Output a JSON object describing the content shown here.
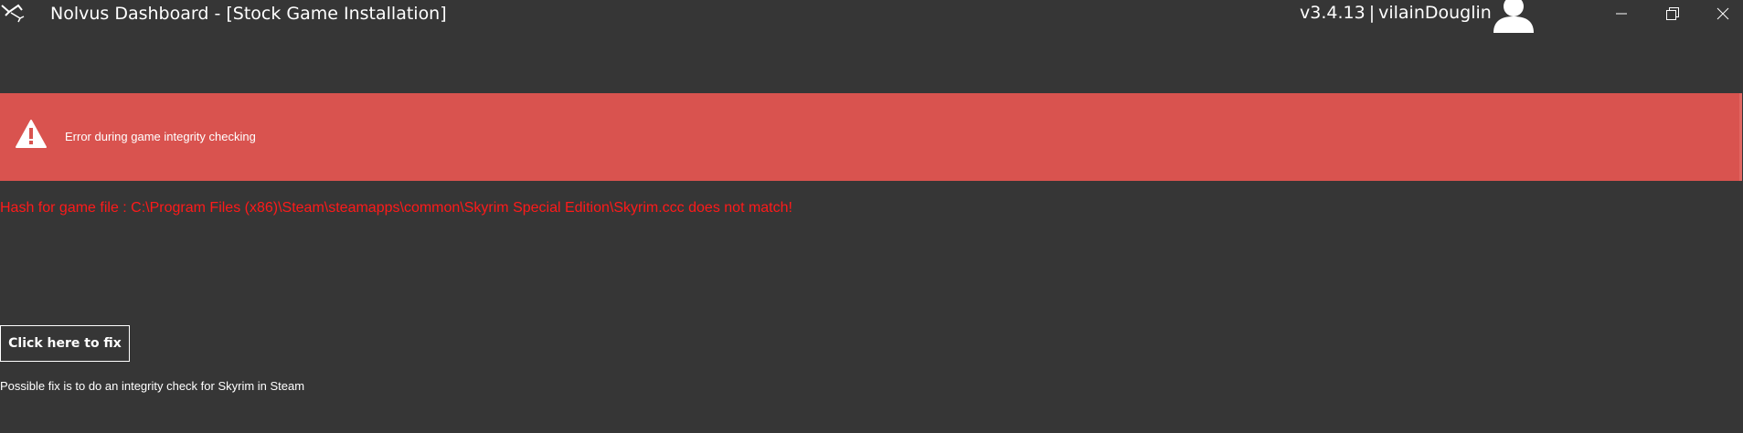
{
  "window": {
    "title": "Nolvus Dashboard - [Stock Game Installation]",
    "version": "v3.4.13",
    "separator": "|",
    "username": "vilainDouglin",
    "controls": [
      "minimize-icon",
      "restore-icon",
      "close-icon"
    ]
  },
  "error_banner": {
    "icon": "warning-icon",
    "title": "Error during game integrity checking",
    "background_color": "#d9534f"
  },
  "error_detail": {
    "message": "Hash for game file : C:\\Program Files (x86)\\Steam\\steamapps\\common\\Skyrim Special Edition\\Skyrim.ccc does not match!",
    "color": "#ff1a1a"
  },
  "fix": {
    "button_label": "Click here to fix",
    "hint": "Possible fix is to do an integrity check for Skyrim in Steam"
  },
  "colors": {
    "window_background": "#363636",
    "text": "#ffffff"
  }
}
